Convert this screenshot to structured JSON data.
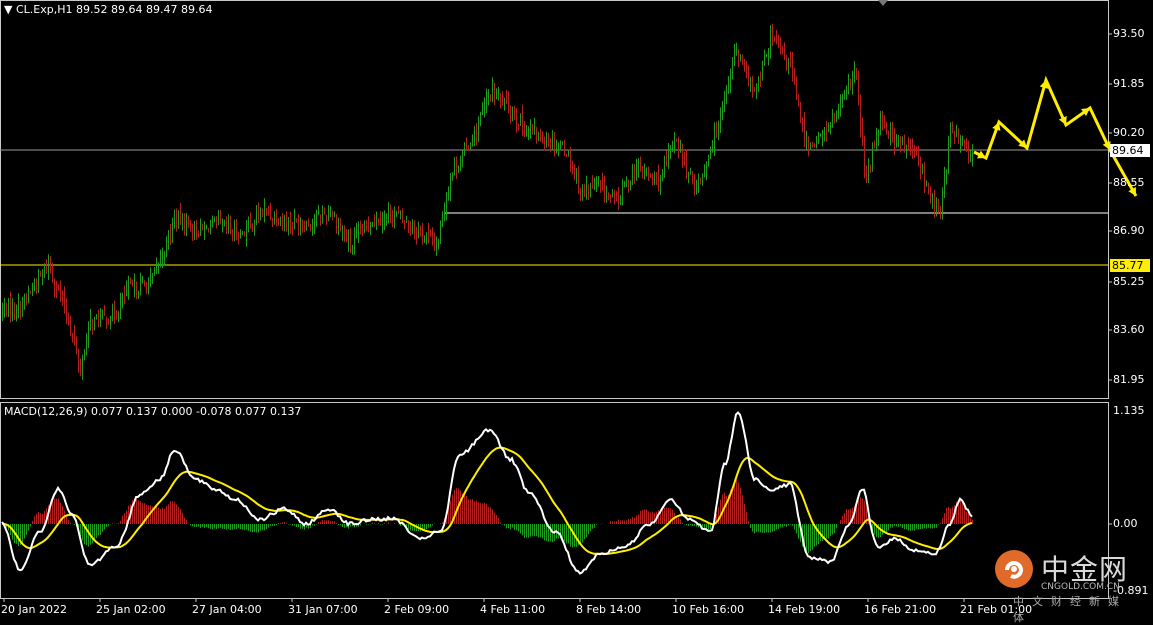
{
  "header": {
    "symbol": "CL.Exp,H1",
    "ohlc": "89.52 89.64 89.47 89.64",
    "macd_label": "MACD(12,26,9) 0.077 0.137 0.000 -0.078 0.077 0.137"
  },
  "price_axis": {
    "ticks": [
      "93.50",
      "91.85",
      "90.20",
      "88.55",
      "86.90",
      "85.25",
      "83.60",
      "81.95"
    ],
    "current_price": "89.64",
    "level_price": "85.77"
  },
  "macd_axis": {
    "ticks": [
      "1.135",
      "0.00",
      "-0.891"
    ]
  },
  "time_axis": {
    "ticks": [
      "20 Jan 2022",
      "25 Jan 02:00",
      "27 Jan 04:00",
      "31 Jan 07:00",
      "2 Feb 09:00",
      "4 Feb 11:00",
      "8 Feb 14:00",
      "10 Feb 16:00",
      "14 Feb 19:00",
      "16 Feb 21:00",
      "21 Feb 01:00"
    ]
  },
  "watermark": {
    "name": "中金网",
    "domain": "CNGOLD.COM.CN",
    "tagline": "中文财经新媒体"
  },
  "colors": {
    "background": "#000000",
    "bull": "#1f9c1f",
    "bear": "#b22020",
    "macd_line": "#ffffff",
    "signal_line": "#ffee00",
    "arrow": "#ffee00",
    "support_line": "#ffffff",
    "level_line": "#ffee00"
  }
}
